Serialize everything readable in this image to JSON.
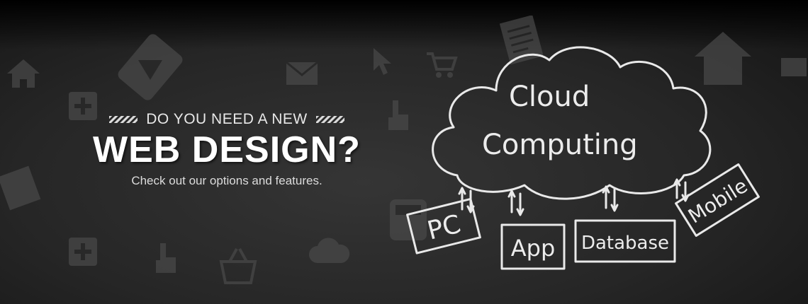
{
  "hero": {
    "eyebrow": "DO YOU NEED A NEW",
    "headline": "WEB DESIGN?",
    "subline": "Check out our options and features."
  },
  "diagram": {
    "cloud_line1": "Cloud",
    "cloud_line2": "Computing",
    "boxes": [
      "PC",
      "App",
      "Database",
      "Mobile"
    ]
  },
  "colors": {
    "background": "#262626",
    "chalk": "#e9e9e9",
    "icon": "#4a4a4a"
  },
  "background_icons": [
    "home-icon",
    "pencil-icon",
    "document-icon",
    "cursor-icon",
    "cart-icon",
    "mail-icon",
    "plus-icon",
    "hand-pointer-icon",
    "calculator-icon",
    "basket-icon",
    "cloud-icon",
    "ticket-icon"
  ]
}
